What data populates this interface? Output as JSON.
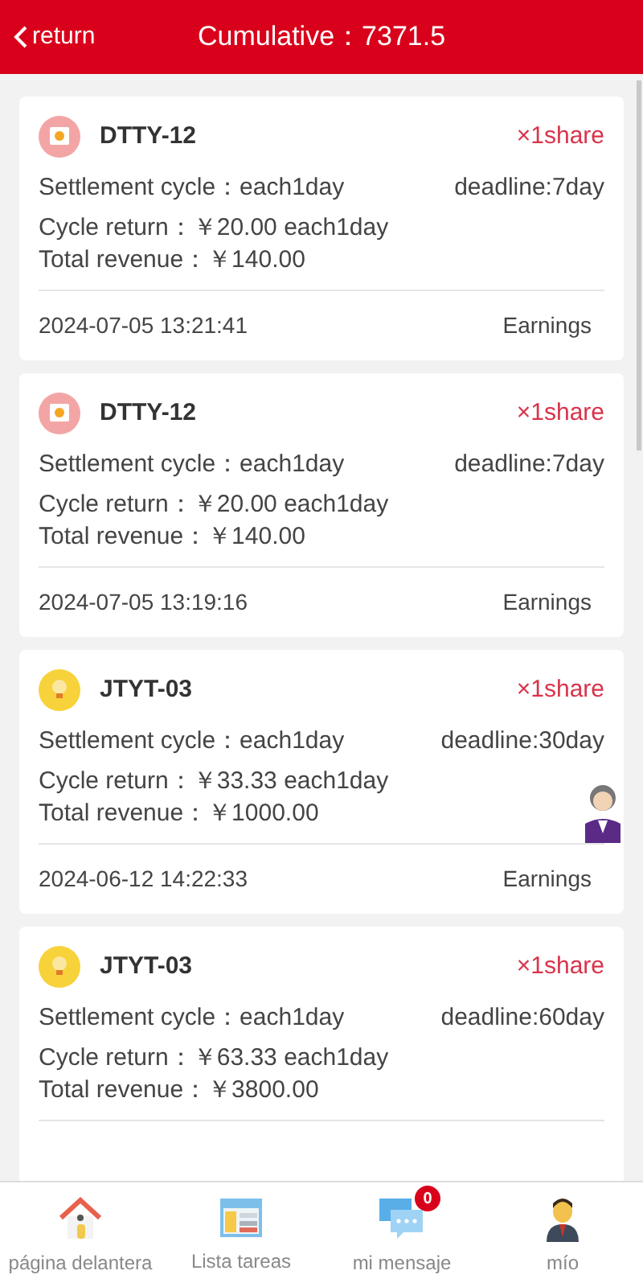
{
  "header": {
    "back": "return",
    "title": "Cumulative：7371.5"
  },
  "orders": [
    {
      "kind": "box",
      "name": "DTTY-12",
      "quantity": "×1share",
      "settlement": "Settlement cycle：each1day",
      "deadline": "deadline:7day",
      "cycle_return": "Cycle return：￥20.00 each1day",
      "total_revenue": "Total revenue：￥140.00",
      "time": "2024-07-05 13:21:41",
      "status": "Earnings"
    },
    {
      "kind": "box",
      "name": "DTTY-12",
      "quantity": "×1share",
      "settlement": "Settlement cycle：each1day",
      "deadline": "deadline:7day",
      "cycle_return": "Cycle return：￥20.00 each1day",
      "total_revenue": "Total revenue：￥140.00",
      "time": "2024-07-05 13:19:16",
      "status": "Earnings"
    },
    {
      "kind": "bulb",
      "name": "JTYT-03",
      "quantity": "×1share",
      "settlement": "Settlement cycle：each1day",
      "deadline": "deadline:30day",
      "cycle_return": "Cycle return：￥33.33 each1day",
      "total_revenue": "Total revenue：￥1000.00",
      "time": "2024-06-12 14:22:33",
      "status": "Earnings"
    },
    {
      "kind": "bulb",
      "name": "JTYT-03",
      "quantity": "×1share",
      "settlement": "Settlement cycle：each1day",
      "deadline": "deadline:60day",
      "cycle_return": "Cycle return：￥63.33 each1day",
      "total_revenue": "Total revenue：￥3800.00"
    }
  ],
  "nav": [
    {
      "kind": "home",
      "label": "página delantera"
    },
    {
      "kind": "tasks",
      "label": "Lista tareas"
    },
    {
      "kind": "message",
      "label": "mi mensaje",
      "badge": "0"
    },
    {
      "kind": "profile",
      "label": "mío"
    }
  ]
}
